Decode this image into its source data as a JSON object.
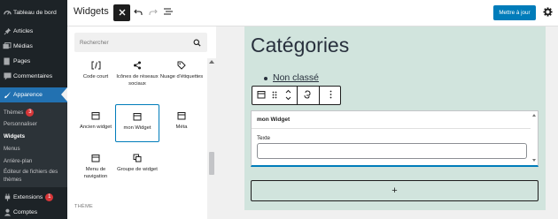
{
  "sidebar": {
    "dashboard": {
      "label": "Tableau de bord",
      "icon": "dashboard-icon"
    },
    "items": [
      {
        "label": "Articles",
        "icon": "pin-icon"
      },
      {
        "label": "Médias",
        "icon": "media-icon"
      },
      {
        "label": "Pages",
        "icon": "page-icon"
      },
      {
        "label": "Commentaires",
        "icon": "comment-icon"
      },
      {
        "label": "Apparence",
        "icon": "brush-icon",
        "active": true
      }
    ],
    "submenu": [
      {
        "label": "Thèmes",
        "badge": "3"
      },
      {
        "label": "Personnaliser"
      },
      {
        "label": "Widgets",
        "current": true
      },
      {
        "label": "Menus"
      },
      {
        "label": "Arrière-plan"
      },
      {
        "label": "Éditeur de fichiers des thèmes"
      }
    ],
    "bottom": [
      {
        "label": "Extensions",
        "badge": "1",
        "icon": "plugin-icon"
      },
      {
        "label": "Comptes",
        "icon": "user-icon"
      }
    ]
  },
  "header": {
    "title": "Widgets",
    "update_label": "Mettre à jour"
  },
  "inserter": {
    "search_placeholder": "Rechercher",
    "blocks": [
      {
        "label": "Code court",
        "icon": "shortcode-icon"
      },
      {
        "label": "Icônes de réseaux sociaux",
        "icon": "share-icon"
      },
      {
        "label": "Nuage d’étiquettes",
        "icon": "tag-icon"
      },
      {
        "label": "Ancien widget",
        "icon": "calendar-icon"
      },
      {
        "label": "mon Widget",
        "icon": "calendar-icon",
        "selected": true
      },
      {
        "label": "Méta",
        "icon": "calendar-icon"
      },
      {
        "label": "Menu de navigation",
        "icon": "calendar-icon"
      },
      {
        "label": "Groupe de widget",
        "icon": "group-icon"
      }
    ],
    "section_label": "THÈME"
  },
  "canvas": {
    "heading": "Catégories",
    "list_item": "Non classé",
    "widget": {
      "title": "mon Widget",
      "field_label": "Texte",
      "field_value": ""
    },
    "add_symbol": "+"
  },
  "colors": {
    "sidebar_bg": "#1d2327",
    "accent": "#2271b1",
    "button_blue": "#007cba",
    "content_bg": "#d1e4dd",
    "badge_red": "#d63638"
  }
}
